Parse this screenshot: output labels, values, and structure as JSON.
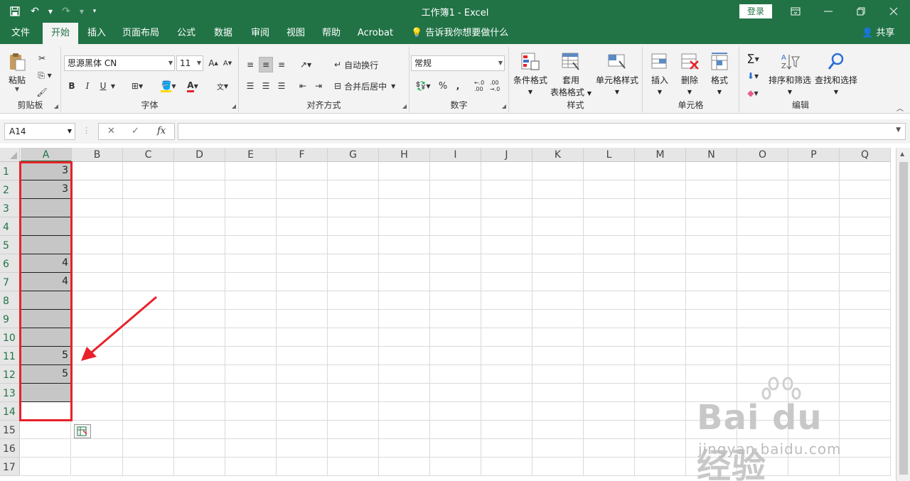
{
  "window": {
    "title": "工作簿1  -  Excel",
    "login_label": "登录"
  },
  "tabs": [
    "文件",
    "开始",
    "插入",
    "页面布局",
    "公式",
    "数据",
    "审阅",
    "视图",
    "帮助",
    "Acrobat"
  ],
  "active_tab": "开始",
  "tell_me": "告诉我你想要做什么",
  "share_label": "共享",
  "ribbon": {
    "clipboard": {
      "paste": "粘贴",
      "label": "剪贴板"
    },
    "font": {
      "name": "思源黑体 CN",
      "size": "11",
      "bold": "B",
      "italic": "I",
      "underline": "U",
      "label": "字体"
    },
    "alignment": {
      "wrap": "自动换行",
      "merge": "合并后居中",
      "label": "对齐方式"
    },
    "number": {
      "format": "常规",
      "percent": "%",
      "comma": ",",
      "label": "数字"
    },
    "styles": {
      "conditional": "条件格式",
      "table_line1": "套用",
      "table_line2": "表格格式",
      "cell_styles": "单元格样式",
      "label": "样式"
    },
    "cells": {
      "insert": "插入",
      "delete": "删除",
      "format": "格式",
      "label": "单元格"
    },
    "editing": {
      "sort": "排序和筛选",
      "find": "查找和选择",
      "label": "编辑"
    }
  },
  "formula_bar": {
    "name_box": "A14",
    "fx": "fx",
    "value": ""
  },
  "columns": [
    "A",
    "B",
    "C",
    "D",
    "E",
    "F",
    "G",
    "H",
    "I",
    "J",
    "K",
    "L",
    "M",
    "N",
    "O",
    "P",
    "Q"
  ],
  "active_column": "A",
  "rows": [
    "1",
    "2",
    "3",
    "4",
    "5",
    "6",
    "7",
    "8",
    "9",
    "10",
    "11",
    "12",
    "13",
    "14",
    "15",
    "16",
    "17"
  ],
  "column_a_values": [
    "3",
    "3",
    "",
    "",
    "",
    "4",
    "4",
    "",
    "",
    "",
    "5",
    "5",
    "",
    "",
    "",
    "",
    ""
  ],
  "selection": {
    "range_rows": "1-14",
    "active_cell": "A14"
  },
  "watermark": {
    "brand": "Bai du 经验",
    "url": "jingyan.baidu.com"
  },
  "colors": {
    "excel_green": "#217346",
    "selection_gray": "#c6c6c6",
    "annotation_red": "#e8212a"
  }
}
